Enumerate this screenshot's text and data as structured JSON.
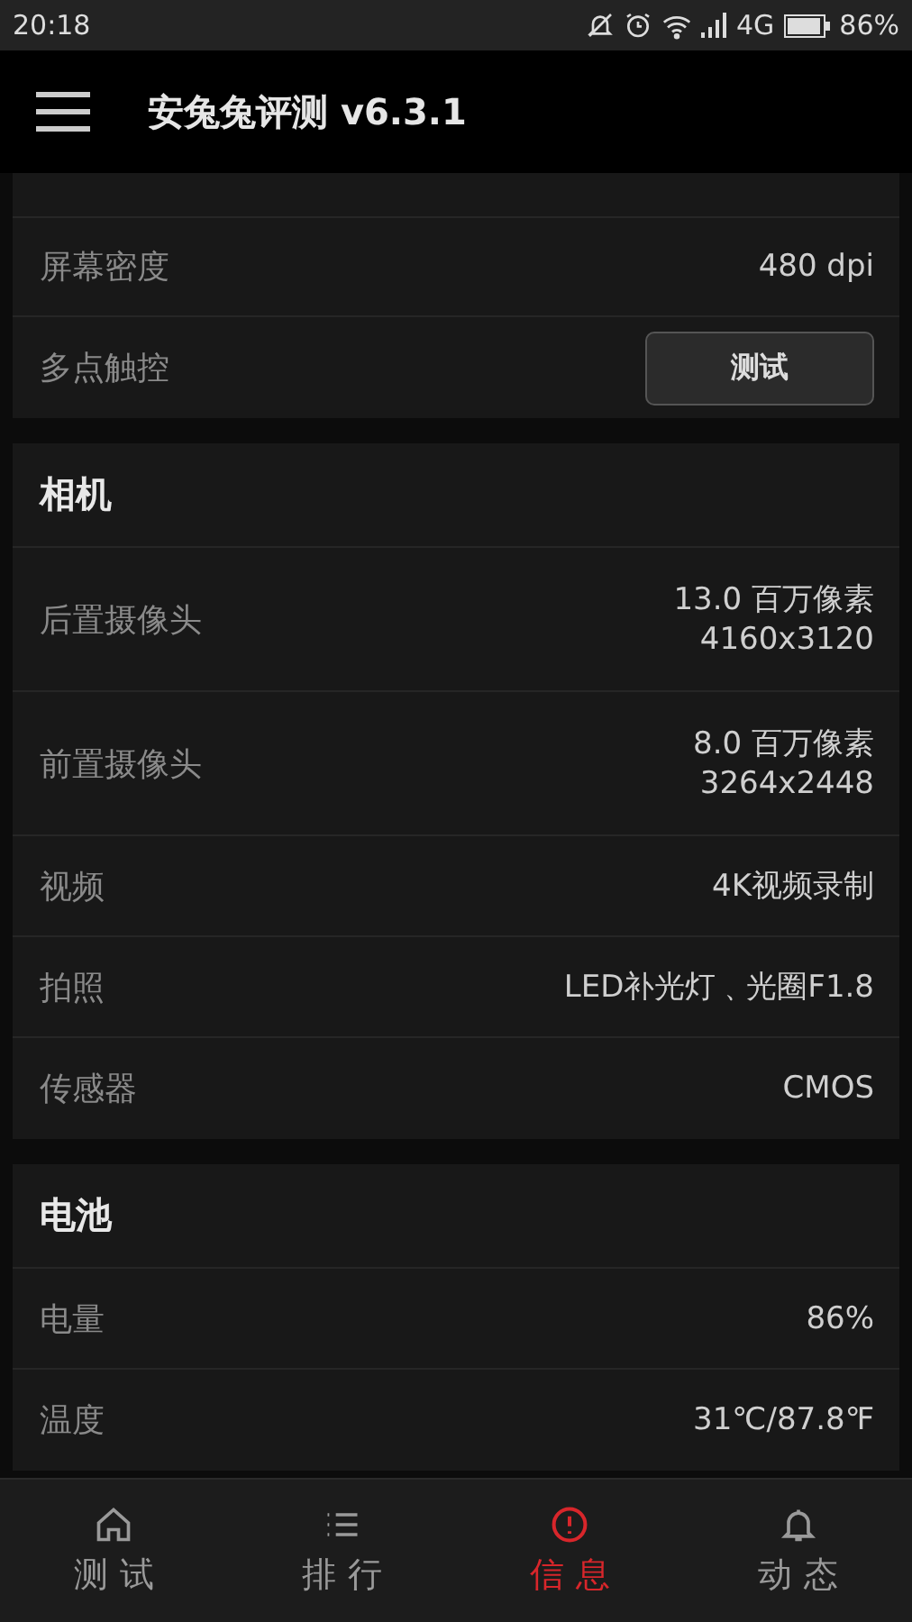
{
  "status_bar": {
    "time": "20:18",
    "network": "4G",
    "battery": "86%"
  },
  "header": {
    "title": "安兔兔评测 v6.3.1"
  },
  "sections": [
    {
      "rows": [
        {
          "kind": "text",
          "label": "屏幕密度",
          "value": "480 dpi"
        },
        {
          "kind": "button",
          "label": "多点触控",
          "button": "测试"
        }
      ]
    },
    {
      "title": "相机",
      "rows": [
        {
          "kind": "text",
          "label": "后置摄像头",
          "value": "13.0 百万像素",
          "value2": "4160x3120"
        },
        {
          "kind": "text",
          "label": "前置摄像头",
          "value": "8.0 百万像素",
          "value2": "3264x2448"
        },
        {
          "kind": "text",
          "label": "视频",
          "value": "4K视频录制"
        },
        {
          "kind": "text",
          "label": "拍照",
          "value": "LED补光灯﹑光圈F1.8"
        },
        {
          "kind": "text",
          "label": "传感器",
          "value": "CMOS"
        }
      ]
    },
    {
      "title": "电池",
      "rows": [
        {
          "kind": "text",
          "label": "电量",
          "value": "86%"
        },
        {
          "kind": "text",
          "label": "温度",
          "value": "31℃/87.8℉"
        }
      ]
    }
  ],
  "bottom_nav": [
    {
      "label": "测 试",
      "selected": false
    },
    {
      "label": "排 行",
      "selected": false
    },
    {
      "label": "信 息",
      "selected": true
    },
    {
      "label": "动 态",
      "selected": false
    }
  ]
}
